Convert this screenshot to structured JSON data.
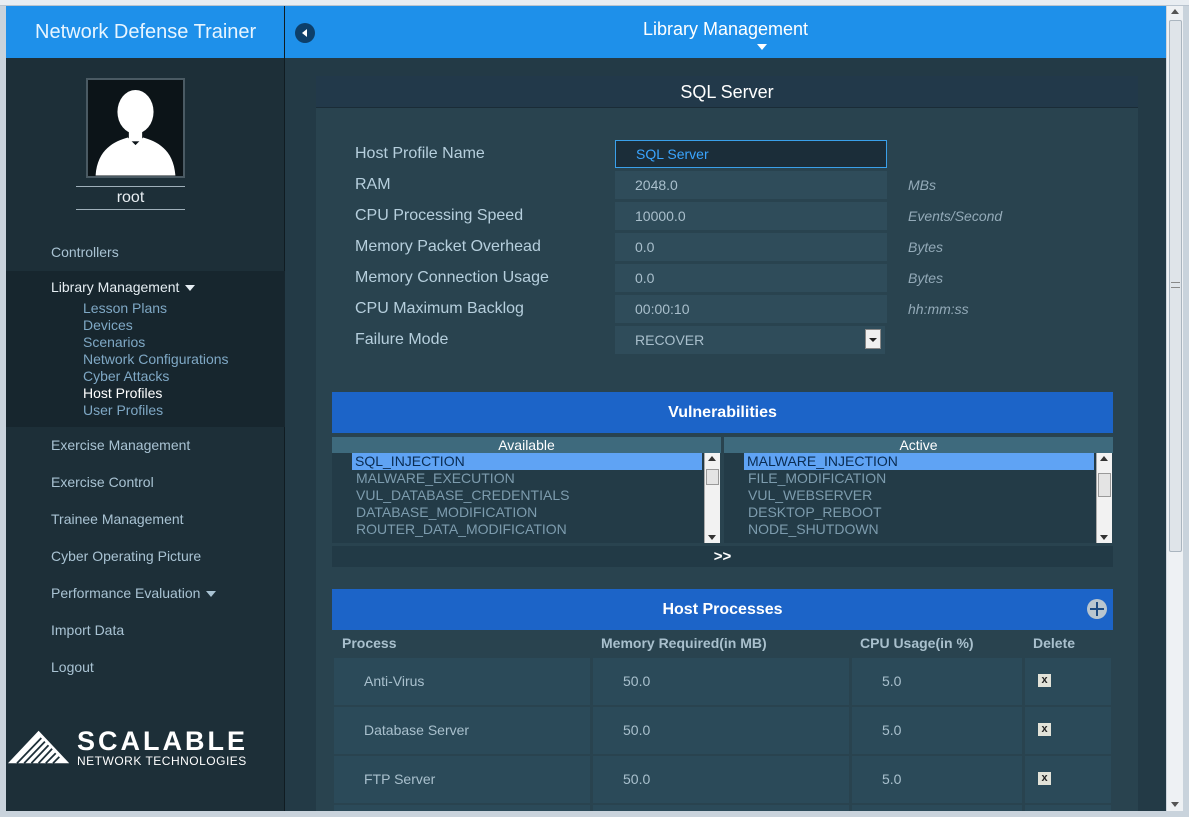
{
  "app": {
    "title": "Network Defense Trainer"
  },
  "user": {
    "name": "root"
  },
  "nav": {
    "items": [
      {
        "label": "Controllers"
      }
    ],
    "library_group": {
      "label": "Library Management",
      "subitems": [
        {
          "label": "Lesson Plans"
        },
        {
          "label": "Devices"
        },
        {
          "label": "Scenarios"
        },
        {
          "label": "Network Configurations"
        },
        {
          "label": "Cyber Attacks"
        },
        {
          "label": "Host Profiles"
        },
        {
          "label": "User Profiles"
        }
      ]
    },
    "lower_items": [
      {
        "label": "Exercise Management"
      },
      {
        "label": "Exercise Control"
      },
      {
        "label": "Trainee Management"
      },
      {
        "label": "Cyber Operating Picture"
      },
      {
        "label": "Performance Evaluation"
      },
      {
        "label": "Import Data"
      },
      {
        "label": "Logout"
      }
    ]
  },
  "logo": {
    "big": "SCALABLE",
    "small": "NETWORK TECHNOLOGIES"
  },
  "header": {
    "title": "Library Management"
  },
  "panel": {
    "title": "SQL Server"
  },
  "form": [
    {
      "label": "Host Profile Name",
      "value": "SQL Server",
      "unit": ""
    },
    {
      "label": "RAM",
      "value": "2048.0",
      "unit": "MBs"
    },
    {
      "label": "CPU Processing Speed",
      "value": "10000.0",
      "unit": "Events/Second"
    },
    {
      "label": "Memory Packet Overhead",
      "value": "0.0",
      "unit": "Bytes"
    },
    {
      "label": "Memory Connection Usage",
      "value": "0.0",
      "unit": "Bytes"
    },
    {
      "label": "CPU Maximum Backlog",
      "value": "00:00:10",
      "unit": "hh:mm:ss"
    },
    {
      "label": "Failure Mode",
      "value": "RECOVER",
      "unit": ""
    }
  ],
  "vulnerabilities": {
    "title": "Vulnerabilities",
    "available_label": "Available",
    "active_label": "Active",
    "available": [
      "SQL_INJECTION",
      "MALWARE_EXECUTION",
      "VUL_DATABASE_CREDENTIALS",
      "DATABASE_MODIFICATION",
      "ROUTER_DATA_MODIFICATION"
    ],
    "active": [
      "MALWARE_INJECTION",
      "FILE_MODIFICATION",
      "VUL_WEBSERVER",
      "DESKTOP_REBOOT",
      "NODE_SHUTDOWN"
    ],
    "move_label": ">>"
  },
  "processes": {
    "title": "Host Processes",
    "columns": {
      "process": "Process",
      "memory": "Memory Required(in MB)",
      "cpu": "CPU Usage(in %)",
      "delete": "Delete"
    },
    "rows": [
      {
        "process": "Anti-Virus",
        "memory": "50.0",
        "cpu": "5.0",
        "delete": "x"
      },
      {
        "process": "Database Server",
        "memory": "50.0",
        "cpu": "5.0",
        "delete": "x"
      },
      {
        "process": "FTP Server",
        "memory": "50.0",
        "cpu": "5.0",
        "delete": "x"
      }
    ]
  },
  "colors": {
    "accent": "#1e90ea",
    "section": "#1c64c8",
    "panel": "#29434f",
    "sidebar": "#1d2f38"
  }
}
